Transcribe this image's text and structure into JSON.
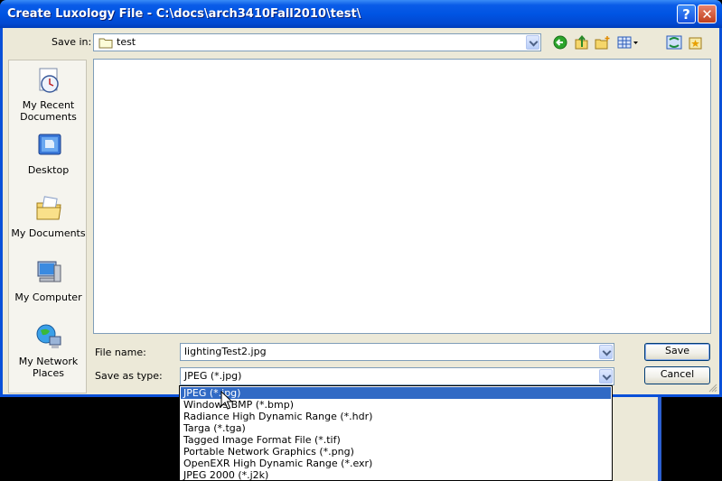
{
  "window": {
    "title": "Create Luxology File - C:\\docs\\arch3410Fall2010\\test\\",
    "help_label": "?",
    "close_label": "✕"
  },
  "save_in": {
    "label": "Save in:",
    "value": "test",
    "icon": "folder-icon"
  },
  "toolbar": {
    "icons": [
      "back-icon",
      "up-folder-icon",
      "new-folder-icon",
      "views-menu-icon",
      "sync-icon",
      "favorites-icon"
    ]
  },
  "places": [
    {
      "label": "My Recent Documents",
      "line1": "My Recent",
      "line2": "Documents",
      "icon": "recent-documents-icon"
    },
    {
      "label": "Desktop",
      "line1": "Desktop",
      "line2": "",
      "icon": "desktop-icon"
    },
    {
      "label": "My Documents",
      "line1": "My Documents",
      "line2": "",
      "icon": "my-documents-icon"
    },
    {
      "label": "My Computer",
      "line1": "My Computer",
      "line2": "",
      "icon": "my-computer-icon"
    },
    {
      "label": "My Network Places",
      "line1": "My Network",
      "line2": "Places",
      "icon": "network-places-icon"
    }
  ],
  "file_name": {
    "label": "File name:",
    "value": "lightingTest2.jpg"
  },
  "save_as_type": {
    "label": "Save as type:",
    "value": "JPEG (*.jpg)",
    "options": [
      "JPEG (*.jpg)",
      "Windows BMP (*.bmp)",
      "Radiance High Dynamic Range (*.hdr)",
      "Targa (*.tga)",
      "Tagged Image Format File (*.tif)",
      "Portable Network Graphics (*.png)",
      "OpenEXR High Dynamic Range (*.exr)",
      "JPEG 2000 (*.j2k)"
    ],
    "selected_index": 0
  },
  "buttons": {
    "save": "Save",
    "cancel": "Cancel"
  },
  "colors": {
    "title_bar": "#0054e3",
    "selection": "#316ac5",
    "dialog_bg": "#ece9d8"
  }
}
